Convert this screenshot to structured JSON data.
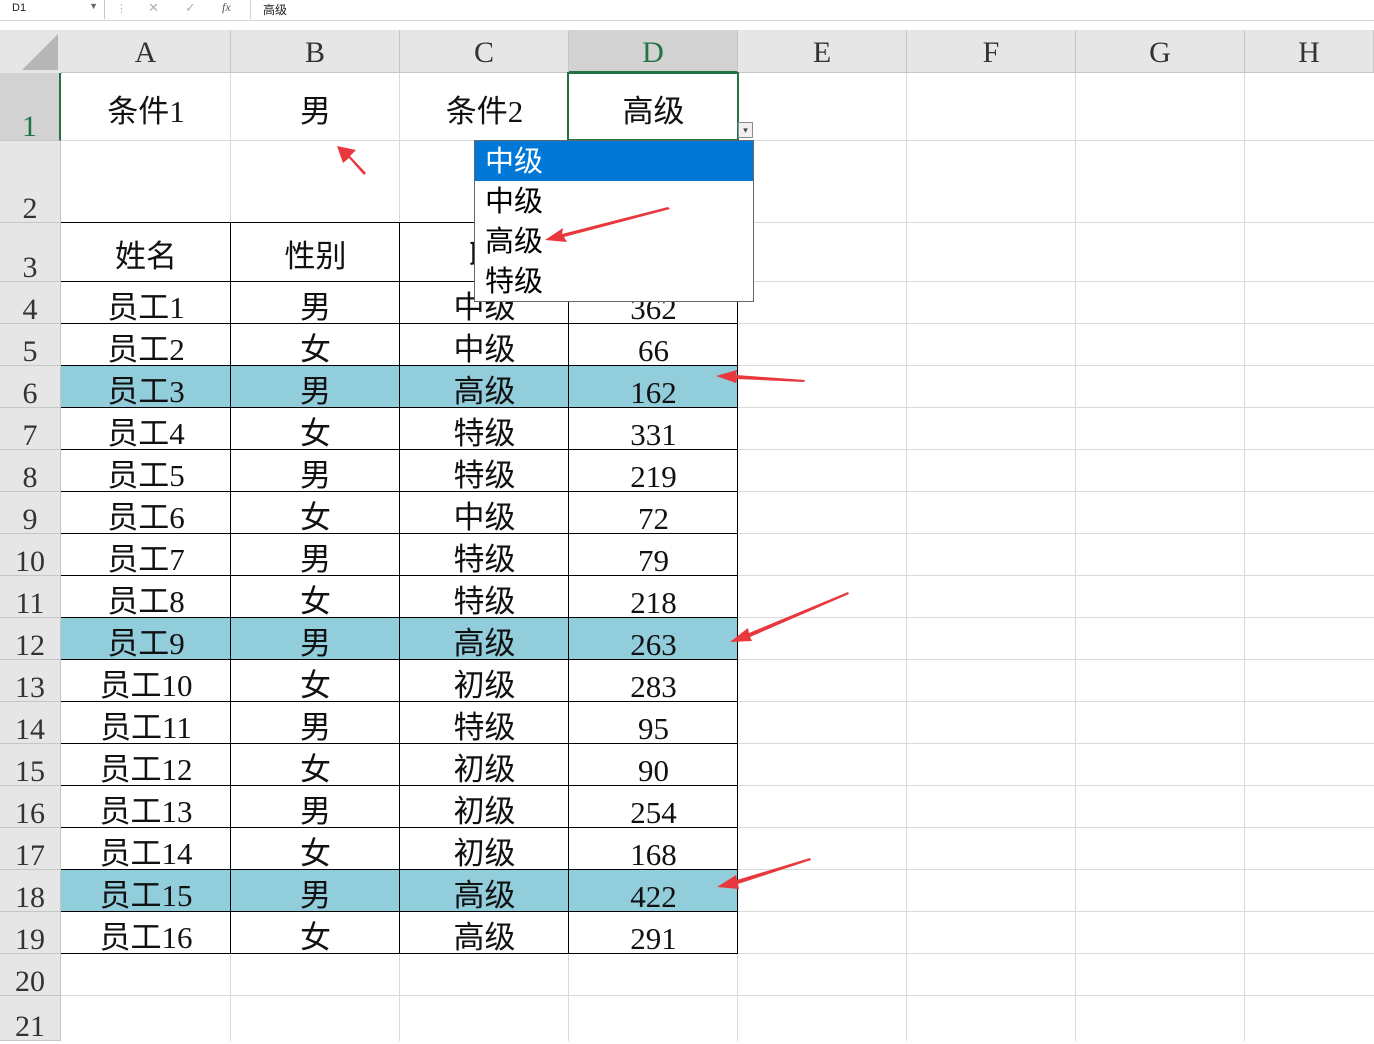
{
  "formula_bar": {
    "name_box": "D1",
    "cancel_icon": "✕",
    "confirm_icon": "✓",
    "fx_label": "fx",
    "value": "高级"
  },
  "columns": [
    "A",
    "B",
    "C",
    "D",
    "E",
    "F",
    "G",
    "H"
  ],
  "rows": [
    "1",
    "2",
    "3",
    "4",
    "5",
    "6",
    "7",
    "8",
    "9",
    "10",
    "11",
    "12",
    "13",
    "14",
    "15",
    "16",
    "17",
    "18",
    "19",
    "20",
    "21"
  ],
  "criteria": {
    "label1": "条件1",
    "value1": "男",
    "label2": "条件2",
    "value2": "高级"
  },
  "table": {
    "headers": [
      "姓名",
      "性别",
      "职"
    ],
    "rows": [
      {
        "name": "员工1",
        "gender": "男",
        "level": "中级",
        "value": "362"
      },
      {
        "name": "员工2",
        "gender": "女",
        "level": "中级",
        "value": "66"
      },
      {
        "name": "员工3",
        "gender": "男",
        "level": "高级",
        "value": "162",
        "highlight": true
      },
      {
        "name": "员工4",
        "gender": "女",
        "level": "特级",
        "value": "331"
      },
      {
        "name": "员工5",
        "gender": "男",
        "level": "特级",
        "value": "219"
      },
      {
        "name": "员工6",
        "gender": "女",
        "level": "中级",
        "value": "72"
      },
      {
        "name": "员工7",
        "gender": "男",
        "level": "特级",
        "value": "79"
      },
      {
        "name": "员工8",
        "gender": "女",
        "level": "特级",
        "value": "218"
      },
      {
        "name": "员工9",
        "gender": "男",
        "level": "高级",
        "value": "263",
        "highlight": true
      },
      {
        "name": "员工10",
        "gender": "女",
        "level": "初级",
        "value": "283"
      },
      {
        "name": "员工11",
        "gender": "男",
        "level": "特级",
        "value": "95"
      },
      {
        "name": "员工12",
        "gender": "女",
        "level": "初级",
        "value": "90"
      },
      {
        "name": "员工13",
        "gender": "男",
        "level": "初级",
        "value": "254"
      },
      {
        "name": "员工14",
        "gender": "女",
        "level": "初级",
        "value": "168"
      },
      {
        "name": "员工15",
        "gender": "男",
        "level": "高级",
        "value": "422",
        "highlight": true
      },
      {
        "name": "员工16",
        "gender": "女",
        "level": "高级",
        "value": "291"
      }
    ]
  },
  "dropdown": {
    "options": [
      "中级",
      "中级",
      "高级",
      "特级"
    ],
    "selected_index": 0
  },
  "colors": {
    "highlight": "#92cddc",
    "selection": "#217346",
    "dropdown_selected": "#0078d7",
    "arrow": "#e8383d"
  }
}
